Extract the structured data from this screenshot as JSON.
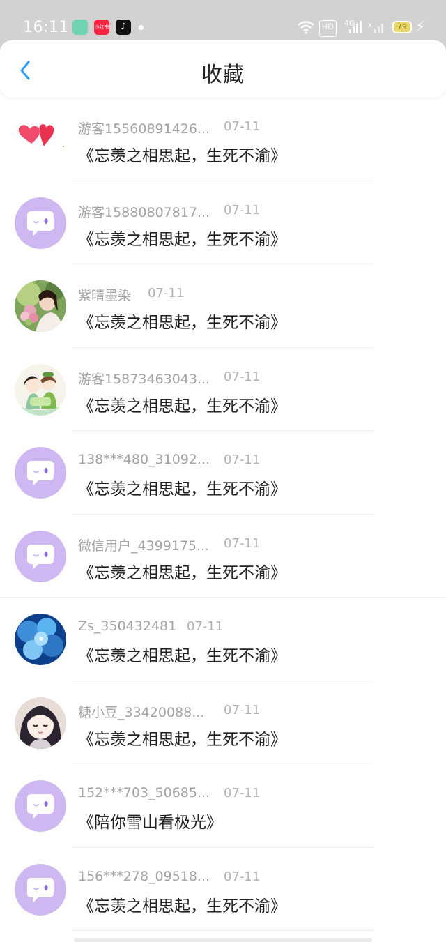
{
  "status_bar": {
    "time": "16:11",
    "apps": [
      "app-green",
      "小红书",
      "♪"
    ],
    "hd_label": "HD",
    "signal_label": "4G",
    "battery": "79"
  },
  "header": {
    "title": "收藏"
  },
  "items": [
    {
      "user": "游客15560891426...",
      "date": "07-11",
      "title": "《忘羡之相思起，生死不渝》",
      "avatar": "hearts"
    },
    {
      "user": "游客15880807817...",
      "date": "07-11",
      "title": "《忘羡之相思起，生死不渝》",
      "avatar": "default"
    },
    {
      "user": "紫晴墨染",
      "date": "07-11",
      "title": "《忘羡之相思起，生死不渝》",
      "avatar": "photo-woman"
    },
    {
      "user": "游客15873463043...",
      "date": "07-11",
      "title": "《忘羡之相思起，生死不渝》",
      "avatar": "cartoon-couple"
    },
    {
      "user": "138***480_31092...",
      "date": "07-11",
      "title": "《忘羡之相思起，生死不渝》",
      "avatar": "default"
    },
    {
      "user": "微信用户_4399175...",
      "date": "07-11",
      "title": "《忘羡之相思起，生死不渝》",
      "avatar": "default"
    },
    {
      "user": "Zs_350432481",
      "date": "07-11",
      "title": "《忘羡之相思起，生死不渝》",
      "avatar": "blue-flower"
    },
    {
      "user": "糖小豆_33420088...",
      "date": "07-11",
      "title": "《忘羡之相思起，生死不渝》",
      "avatar": "anime-girl"
    },
    {
      "user": "152***703_50685...",
      "date": "07-11",
      "title": "《陪你雪山看极光》",
      "avatar": "default"
    },
    {
      "user": "156***278_09518...",
      "date": "07-11",
      "title": "《忘羡之相思起，生死不渝》",
      "avatar": "default"
    }
  ],
  "colors": {
    "accent": "#2a9df4",
    "default_avatar": "#cfb8f1",
    "status_bar": "#d2d2d2"
  }
}
